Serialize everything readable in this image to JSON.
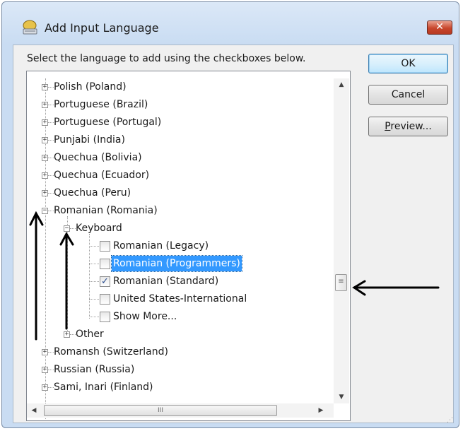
{
  "window": {
    "title": "Add Input Language",
    "close_label": "✕"
  },
  "instructions": "Select the language to add using the checkboxes below.",
  "buttons": {
    "ok": "OK",
    "cancel": "Cancel",
    "preview_prefix": "P",
    "preview_rest": "review..."
  },
  "tree": {
    "languages_top": [
      "Polish (Poland)",
      "Portuguese (Brazil)",
      "Portuguese (Portugal)",
      "Punjabi (India)",
      "Quechua (Bolivia)",
      "Quechua (Ecuador)",
      "Quechua (Peru)"
    ],
    "expanded_language": "Romanian (Romania)",
    "keyboard_group": "Keyboard",
    "keyboards": [
      {
        "label": "Romanian (Legacy)",
        "checked": false,
        "selected": false
      },
      {
        "label": "Romanian (Programmers)",
        "checked": false,
        "selected": true
      },
      {
        "label": "Romanian (Standard)",
        "checked": true,
        "selected": false
      },
      {
        "label": "United States-International",
        "checked": false,
        "selected": false
      },
      {
        "label": "Show More...",
        "checked": false,
        "selected": false
      }
    ],
    "other_group": "Other",
    "languages_bottom": [
      "Romansh (Switzerland)",
      "Russian (Russia)",
      "Sami, Inari (Finland)"
    ]
  },
  "colors": {
    "selection": "#3399ff",
    "annotation": "#000000"
  }
}
